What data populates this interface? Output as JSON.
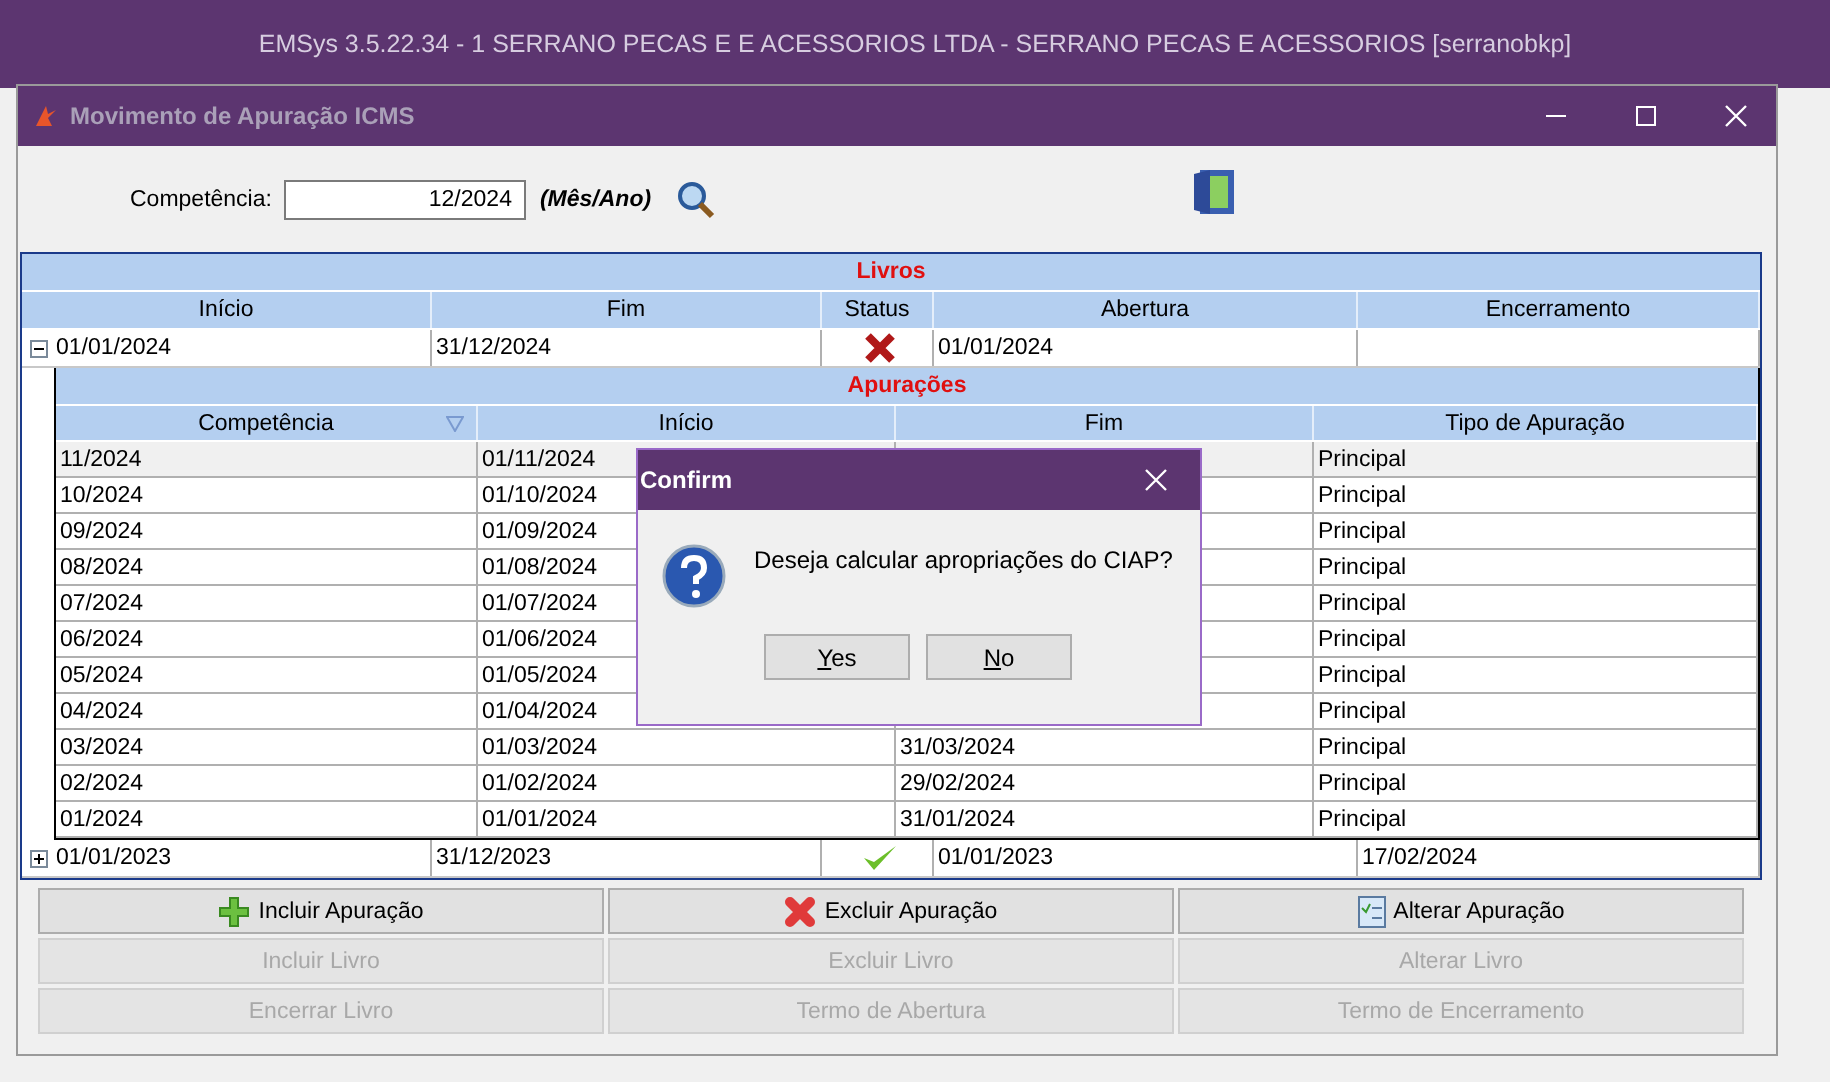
{
  "app_title": "EMSys 3.5.22.34 - 1 SERRANO PECAS E E ACESSORIOS LTDA - SERRANO PECAS E ACESSORIOS [serranobkp]",
  "window": {
    "title": "Movimento de Apuração ICMS"
  },
  "competencia": {
    "label": "Competência:",
    "value": "12/2024",
    "hint": "(Mês/Ano)"
  },
  "livros": {
    "title": "Livros",
    "columns": [
      "Início",
      "Fim",
      "Status",
      "Abertura",
      "Encerramento"
    ],
    "rows": [
      {
        "inicio": "01/01/2024",
        "fim": "31/12/2024",
        "kind": "error",
        "abertura": "01/01/2024",
        "expanded": true,
        "apuracoes": {
          "title": "Apurações",
          "columns": [
            "Competência",
            "Início",
            "Fim",
            "Tipo de Apuração"
          ],
          "rows": [
            {
              "competencia": "11/2024",
              "inicio": "01/11/2024",
              "tipo": "Principal"
            },
            {
              "competencia": "10/2024",
              "inicio": "01/10/2024",
              "tipo": "Principal"
            },
            {
              "competencia": "09/2024",
              "inicio": "01/09/2024",
              "tipo": "Principal"
            },
            {
              "competencia": "08/2024",
              "inicio": "01/08/2024",
              "tipo": "Principal"
            },
            {
              "competencia": "07/2024",
              "inicio": "01/07/2024",
              "tipo": "Principal"
            },
            {
              "competencia": "06/2024",
              "inicio": "01/06/2024",
              "tipo": "Principal"
            },
            {
              "competencia": "05/2024",
              "inicio": "01/05/2024",
              "tipo": "Principal"
            },
            {
              "competencia": "04/2024",
              "inicio": "01/04/2024",
              "tipo": "Principal"
            },
            {
              "competencia": "03/2024",
              "inicio": "01/03/2024",
              "fim": "31/03/2024",
              "tipo": "Principal"
            },
            {
              "competencia": "02/2024",
              "inicio": "01/02/2024",
              "fim": "29/02/2024",
              "tipo": "Principal"
            },
            {
              "competencia": "01/2024",
              "inicio": "01/01/2024",
              "fim": "31/01/2024",
              "tipo": "Principal"
            }
          ]
        }
      },
      {
        "inicio": "01/01/2023",
        "fim": "31/12/2023",
        "kind": "ok",
        "abertura": "01/01/2023",
        "encerramento": "17/02/2024",
        "expanded": false
      }
    ]
  },
  "buttons": [
    {
      "label": "Incluir Apuração",
      "kind": "add",
      "disabled": false
    },
    {
      "label": "Excluir Apuração",
      "kind": "delete",
      "disabled": false
    },
    {
      "label": "Alterar Apuração",
      "kind": "edit",
      "disabled": false
    },
    {
      "label": "Incluir Livro",
      "disabled": true
    },
    {
      "label": "Excluir Livro",
      "disabled": true
    },
    {
      "label": "Alterar Livro",
      "disabled": true
    },
    {
      "label": "Encerrar Livro",
      "disabled": true
    },
    {
      "label": "Termo de Abertura",
      "disabled": true
    },
    {
      "label": "Termo de Encerramento",
      "disabled": true
    }
  ],
  "dialog": {
    "title": "Confirm",
    "message": "Deseja calcular apropriações do CIAP?",
    "buttons": [
      "Yes",
      "No"
    ]
  }
}
